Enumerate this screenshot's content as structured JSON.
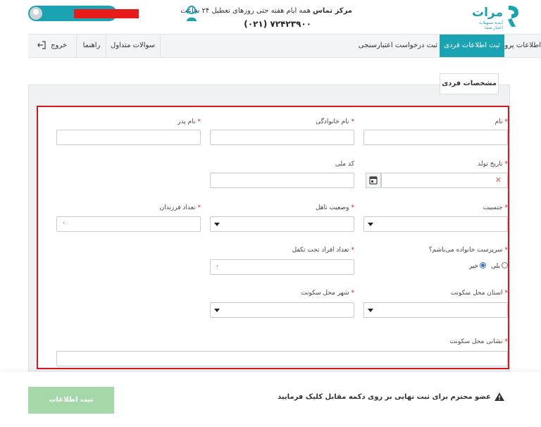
{
  "header": {
    "brand": "مرات",
    "tagline_1": "آینده تسهیلات",
    "tagline_2": "اعتبار شما",
    "contact_title": "مرکز تماس",
    "contact_text": "همه ایام هفته حتی روزهای تعطیل ۲۴ ساعت",
    "phone": "(۰۲۱) ۷۲۴۲۳۹۰۰"
  },
  "nav": {
    "tabs": [
      {
        "label": "اطلاعات پرونده‌ها",
        "active": false
      },
      {
        "label": "ثبت اطلاعات فردی",
        "active": true
      },
      {
        "label": "ثبت درخواست اعتبارسنجی",
        "active": false
      }
    ],
    "faq": "سوالات متداول",
    "guide": "راهنما",
    "exit": "خروج"
  },
  "form": {
    "legend": "مشخصات فردی",
    "first_name": {
      "label": "نام",
      "value": ""
    },
    "last_name": {
      "label": "نام خانوادگی",
      "value": ""
    },
    "father_name": {
      "label": "نام پدر",
      "value": ""
    },
    "birth_date": {
      "label": "تاریخ تولد",
      "value": ""
    },
    "national_code": {
      "label": "کد ملی",
      "value": ""
    },
    "gender": {
      "label": "جنسیت",
      "value": ""
    },
    "marital_status": {
      "label": "وضعیت تاهل",
      "value": ""
    },
    "children_count": {
      "label": "تعداد فرزندان",
      "value": "۰"
    },
    "head_of_household": {
      "label": "سرپرست خانواده می‌باشم؟",
      "yes": "بلی",
      "no": "خیر",
      "selected": "no"
    },
    "dependents_count": {
      "label": "تعداد افراد تحت تکفل",
      "value": "۰"
    },
    "province": {
      "label": "استان محل سکونت",
      "value": ""
    },
    "city": {
      "label": "شهر محل سکونت",
      "value": ""
    },
    "address": {
      "label": "نشانی محل سکونت",
      "value": ""
    }
  },
  "footer": {
    "submit": "ثبت اطلاعات",
    "notice": "عضو محترم برای ثبت نهایی بر روی دکمه مقابل کلیک فرمایید"
  },
  "colors": {
    "brand": "#1aa3b2",
    "required": "#d6191f",
    "submit_disabled": "#a4d8a8"
  }
}
